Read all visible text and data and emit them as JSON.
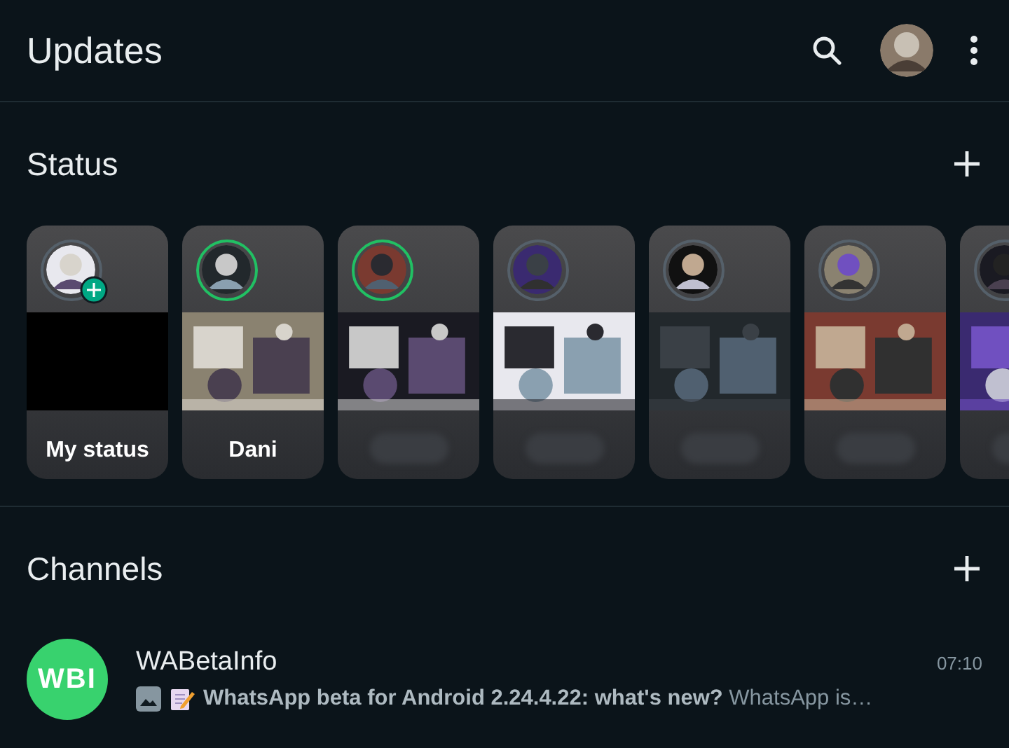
{
  "header": {
    "title": "Updates"
  },
  "status": {
    "title": "Status",
    "cards": [
      {
        "kind": "own",
        "name": "My status",
        "unseen": false
      },
      {
        "kind": "contact",
        "name": "Dani",
        "unseen": true
      },
      {
        "kind": "contact",
        "unseen": true
      },
      {
        "kind": "contact",
        "unseen": false
      },
      {
        "kind": "contact",
        "unseen": false
      },
      {
        "kind": "contact",
        "unseen": false
      },
      {
        "kind": "contact",
        "unseen": false
      }
    ]
  },
  "channels": {
    "title": "Channels",
    "items": [
      {
        "name": "WABetaInfo",
        "logo": "WBI",
        "time": "07:10",
        "message": "**WhatsApp beta for Android 2.24.4.22: what's new?**  WhatsApp is…"
      }
    ]
  }
}
